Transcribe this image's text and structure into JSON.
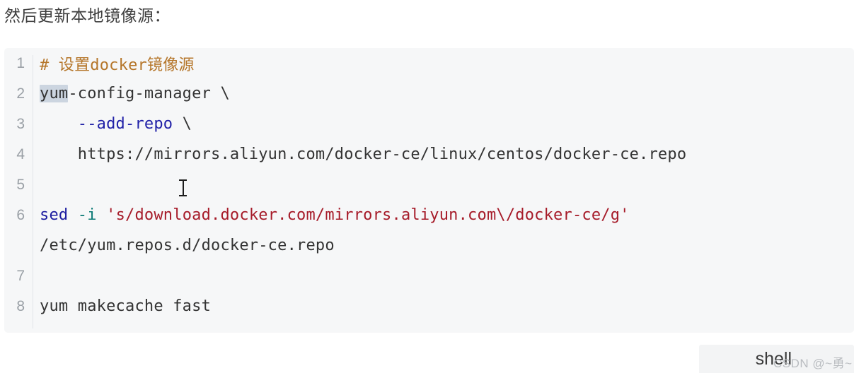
{
  "heading": "然后更新本地镜像源：",
  "code_block": {
    "language_label": "shell",
    "selection_text": "yum",
    "lines": [
      {
        "number": "1",
        "segments": [
          {
            "text": "# 设置docker镜像源",
            "type": "comment"
          }
        ]
      },
      {
        "number": "2",
        "segments": [
          {
            "text": "yum",
            "type": "selected"
          },
          {
            "text": "-config-manager \\",
            "type": "plain"
          }
        ]
      },
      {
        "number": "3",
        "segments": [
          {
            "text": "    ",
            "type": "plain"
          },
          {
            "text": "--add-repo",
            "type": "option"
          },
          {
            "text": " \\",
            "type": "plain"
          }
        ]
      },
      {
        "number": "4",
        "segments": [
          {
            "text": "    https://mirrors.aliyun.com/docker-ce/linux/centos/docker-ce.repo",
            "type": "plain"
          }
        ]
      },
      {
        "number": "5",
        "segments": [
          {
            "text": "",
            "type": "plain"
          }
        ]
      },
      {
        "number": "6",
        "segments": [
          {
            "text": "sed",
            "type": "builtin"
          },
          {
            "text": " ",
            "type": "plain"
          },
          {
            "text": "-i",
            "type": "flag"
          },
          {
            "text": " ",
            "type": "plain"
          },
          {
            "text": "'s/download.docker.com/mirrors.aliyun.com\\/docker-ce/g'",
            "type": "string"
          }
        ]
      },
      {
        "number": "",
        "segments": [
          {
            "text": "/etc/yum.repos.d/docker-ce.repo",
            "type": "plain"
          }
        ]
      },
      {
        "number": "7",
        "segments": [
          {
            "text": "",
            "type": "plain"
          }
        ]
      },
      {
        "number": "8",
        "segments": [
          {
            "text": "yum makecache fast",
            "type": "plain"
          }
        ]
      }
    ]
  },
  "watermark": "CSDN @~勇~",
  "colors": {
    "page_bg": "#ffffff",
    "code_bg": "#f6f7f8",
    "comment": "#b5762a",
    "builtin": "#1c1ca0",
    "flag": "#0b7a76",
    "option": "#2222a8",
    "string": "#a61b29",
    "plain": "#333333",
    "selection": "#ccd5e0",
    "line_number": "#9aa0a6",
    "heading": "#3f3f3f",
    "watermark": "#b9bcc0"
  }
}
